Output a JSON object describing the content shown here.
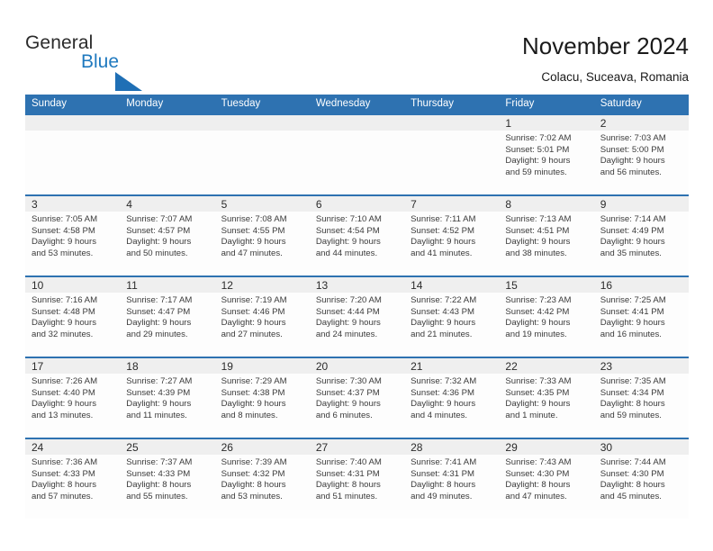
{
  "brand": {
    "word_one": "General",
    "word_two": "Blue",
    "flag_icon": "triangle-flag-icon",
    "accent_color": "#1f79bf"
  },
  "header": {
    "title": "November 2024",
    "location": "Colacu, Suceava, Romania"
  },
  "theme": {
    "header_blue": "#2e72b1",
    "daynum_band": "#efefef",
    "cell_background": "#fdfdfd",
    "text_color": "#3b3b3b"
  },
  "calendar": {
    "day_headers": [
      "Sunday",
      "Monday",
      "Tuesday",
      "Wednesday",
      "Thursday",
      "Friday",
      "Saturday"
    ],
    "weeks": [
      [
        {
          "day": "",
          "sunrise": "",
          "sunset": "",
          "daylight_a": "",
          "daylight_b": ""
        },
        {
          "day": "",
          "sunrise": "",
          "sunset": "",
          "daylight_a": "",
          "daylight_b": ""
        },
        {
          "day": "",
          "sunrise": "",
          "sunset": "",
          "daylight_a": "",
          "daylight_b": ""
        },
        {
          "day": "",
          "sunrise": "",
          "sunset": "",
          "daylight_a": "",
          "daylight_b": ""
        },
        {
          "day": "",
          "sunrise": "",
          "sunset": "",
          "daylight_a": "",
          "daylight_b": ""
        },
        {
          "day": "1",
          "sunrise": "Sunrise: 7:02 AM",
          "sunset": "Sunset: 5:01 PM",
          "daylight_a": "Daylight: 9 hours",
          "daylight_b": "and 59 minutes."
        },
        {
          "day": "2",
          "sunrise": "Sunrise: 7:03 AM",
          "sunset": "Sunset: 5:00 PM",
          "daylight_a": "Daylight: 9 hours",
          "daylight_b": "and 56 minutes."
        }
      ],
      [
        {
          "day": "3",
          "sunrise": "Sunrise: 7:05 AM",
          "sunset": "Sunset: 4:58 PM",
          "daylight_a": "Daylight: 9 hours",
          "daylight_b": "and 53 minutes."
        },
        {
          "day": "4",
          "sunrise": "Sunrise: 7:07 AM",
          "sunset": "Sunset: 4:57 PM",
          "daylight_a": "Daylight: 9 hours",
          "daylight_b": "and 50 minutes."
        },
        {
          "day": "5",
          "sunrise": "Sunrise: 7:08 AM",
          "sunset": "Sunset: 4:55 PM",
          "daylight_a": "Daylight: 9 hours",
          "daylight_b": "and 47 minutes."
        },
        {
          "day": "6",
          "sunrise": "Sunrise: 7:10 AM",
          "sunset": "Sunset: 4:54 PM",
          "daylight_a": "Daylight: 9 hours",
          "daylight_b": "and 44 minutes."
        },
        {
          "day": "7",
          "sunrise": "Sunrise: 7:11 AM",
          "sunset": "Sunset: 4:52 PM",
          "daylight_a": "Daylight: 9 hours",
          "daylight_b": "and 41 minutes."
        },
        {
          "day": "8",
          "sunrise": "Sunrise: 7:13 AM",
          "sunset": "Sunset: 4:51 PM",
          "daylight_a": "Daylight: 9 hours",
          "daylight_b": "and 38 minutes."
        },
        {
          "day": "9",
          "sunrise": "Sunrise: 7:14 AM",
          "sunset": "Sunset: 4:49 PM",
          "daylight_a": "Daylight: 9 hours",
          "daylight_b": "and 35 minutes."
        }
      ],
      [
        {
          "day": "10",
          "sunrise": "Sunrise: 7:16 AM",
          "sunset": "Sunset: 4:48 PM",
          "daylight_a": "Daylight: 9 hours",
          "daylight_b": "and 32 minutes."
        },
        {
          "day": "11",
          "sunrise": "Sunrise: 7:17 AM",
          "sunset": "Sunset: 4:47 PM",
          "daylight_a": "Daylight: 9 hours",
          "daylight_b": "and 29 minutes."
        },
        {
          "day": "12",
          "sunrise": "Sunrise: 7:19 AM",
          "sunset": "Sunset: 4:46 PM",
          "daylight_a": "Daylight: 9 hours",
          "daylight_b": "and 27 minutes."
        },
        {
          "day": "13",
          "sunrise": "Sunrise: 7:20 AM",
          "sunset": "Sunset: 4:44 PM",
          "daylight_a": "Daylight: 9 hours",
          "daylight_b": "and 24 minutes."
        },
        {
          "day": "14",
          "sunrise": "Sunrise: 7:22 AM",
          "sunset": "Sunset: 4:43 PM",
          "daylight_a": "Daylight: 9 hours",
          "daylight_b": "and 21 minutes."
        },
        {
          "day": "15",
          "sunrise": "Sunrise: 7:23 AM",
          "sunset": "Sunset: 4:42 PM",
          "daylight_a": "Daylight: 9 hours",
          "daylight_b": "and 19 minutes."
        },
        {
          "day": "16",
          "sunrise": "Sunrise: 7:25 AM",
          "sunset": "Sunset: 4:41 PM",
          "daylight_a": "Daylight: 9 hours",
          "daylight_b": "and 16 minutes."
        }
      ],
      [
        {
          "day": "17",
          "sunrise": "Sunrise: 7:26 AM",
          "sunset": "Sunset: 4:40 PM",
          "daylight_a": "Daylight: 9 hours",
          "daylight_b": "and 13 minutes."
        },
        {
          "day": "18",
          "sunrise": "Sunrise: 7:27 AM",
          "sunset": "Sunset: 4:39 PM",
          "daylight_a": "Daylight: 9 hours",
          "daylight_b": "and 11 minutes."
        },
        {
          "day": "19",
          "sunrise": "Sunrise: 7:29 AM",
          "sunset": "Sunset: 4:38 PM",
          "daylight_a": "Daylight: 9 hours",
          "daylight_b": "and 8 minutes."
        },
        {
          "day": "20",
          "sunrise": "Sunrise: 7:30 AM",
          "sunset": "Sunset: 4:37 PM",
          "daylight_a": "Daylight: 9 hours",
          "daylight_b": "and 6 minutes."
        },
        {
          "day": "21",
          "sunrise": "Sunrise: 7:32 AM",
          "sunset": "Sunset: 4:36 PM",
          "daylight_a": "Daylight: 9 hours",
          "daylight_b": "and 4 minutes."
        },
        {
          "day": "22",
          "sunrise": "Sunrise: 7:33 AM",
          "sunset": "Sunset: 4:35 PM",
          "daylight_a": "Daylight: 9 hours",
          "daylight_b": "and 1 minute."
        },
        {
          "day": "23",
          "sunrise": "Sunrise: 7:35 AM",
          "sunset": "Sunset: 4:34 PM",
          "daylight_a": "Daylight: 8 hours",
          "daylight_b": "and 59 minutes."
        }
      ],
      [
        {
          "day": "24",
          "sunrise": "Sunrise: 7:36 AM",
          "sunset": "Sunset: 4:33 PM",
          "daylight_a": "Daylight: 8 hours",
          "daylight_b": "and 57 minutes."
        },
        {
          "day": "25",
          "sunrise": "Sunrise: 7:37 AM",
          "sunset": "Sunset: 4:33 PM",
          "daylight_a": "Daylight: 8 hours",
          "daylight_b": "and 55 minutes."
        },
        {
          "day": "26",
          "sunrise": "Sunrise: 7:39 AM",
          "sunset": "Sunset: 4:32 PM",
          "daylight_a": "Daylight: 8 hours",
          "daylight_b": "and 53 minutes."
        },
        {
          "day": "27",
          "sunrise": "Sunrise: 7:40 AM",
          "sunset": "Sunset: 4:31 PM",
          "daylight_a": "Daylight: 8 hours",
          "daylight_b": "and 51 minutes."
        },
        {
          "day": "28",
          "sunrise": "Sunrise: 7:41 AM",
          "sunset": "Sunset: 4:31 PM",
          "daylight_a": "Daylight: 8 hours",
          "daylight_b": "and 49 minutes."
        },
        {
          "day": "29",
          "sunrise": "Sunrise: 7:43 AM",
          "sunset": "Sunset: 4:30 PM",
          "daylight_a": "Daylight: 8 hours",
          "daylight_b": "and 47 minutes."
        },
        {
          "day": "30",
          "sunrise": "Sunrise: 7:44 AM",
          "sunset": "Sunset: 4:30 PM",
          "daylight_a": "Daylight: 8 hours",
          "daylight_b": "and 45 minutes."
        }
      ]
    ]
  }
}
